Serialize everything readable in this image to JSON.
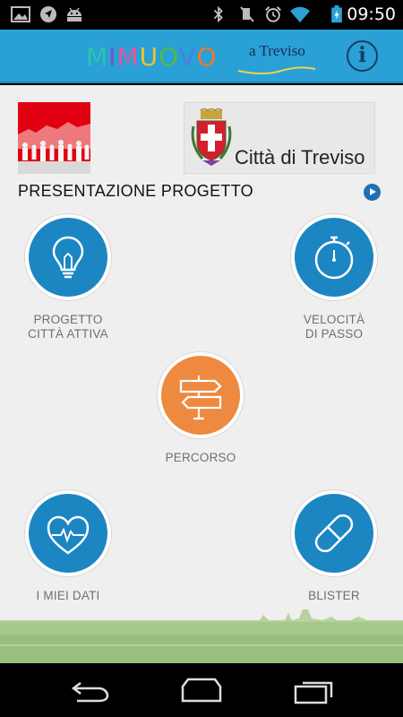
{
  "status_bar": {
    "time": "09:50",
    "icons": [
      "gallery-icon",
      "navigation-icon",
      "android-icon",
      "bluetooth-icon",
      "mute-icon",
      "alarm-icon",
      "wifi-icon",
      "battery-charging-icon"
    ]
  },
  "header": {
    "logo_text": "MIMUOVO",
    "logo_letter_colors": [
      "#2cc4a8",
      "#7e4fc5",
      "#e8559a",
      "#f4c22b",
      "#54b847",
      "#4c7fe0",
      "#ec7a2b"
    ],
    "logo_sub": "a Treviso",
    "info_icon": "info-icon",
    "info_label": "i"
  },
  "partners": {
    "left_logo": "treviso-community-logo",
    "city_name": "Città di Treviso"
  },
  "presentation": {
    "label": "PRESENTAZIONE PROGETTO",
    "icon": "play-icon"
  },
  "menu": {
    "progetto": {
      "label": "PROGETTO\nCITTÀ ATTIVA",
      "icon": "lightbulb-icon"
    },
    "velocita": {
      "label": "VELOCITÀ\nDI PASSO",
      "icon": "stopwatch-icon"
    },
    "percorso": {
      "label": "PERCORSO",
      "icon": "signpost-icon"
    },
    "dati": {
      "label": "I MIEI DATI",
      "icon": "heartbeat-icon"
    },
    "blister": {
      "label": "BLISTER",
      "icon": "pill-icon"
    }
  },
  "colors": {
    "header": "#29a0d6",
    "menu_blue": "#1c86c3",
    "menu_orange": "#ee8940",
    "background": "#efefef",
    "partner_red": "#e10010"
  },
  "nav": {
    "buttons": [
      "back-icon",
      "home-icon",
      "recent-apps-icon"
    ]
  }
}
